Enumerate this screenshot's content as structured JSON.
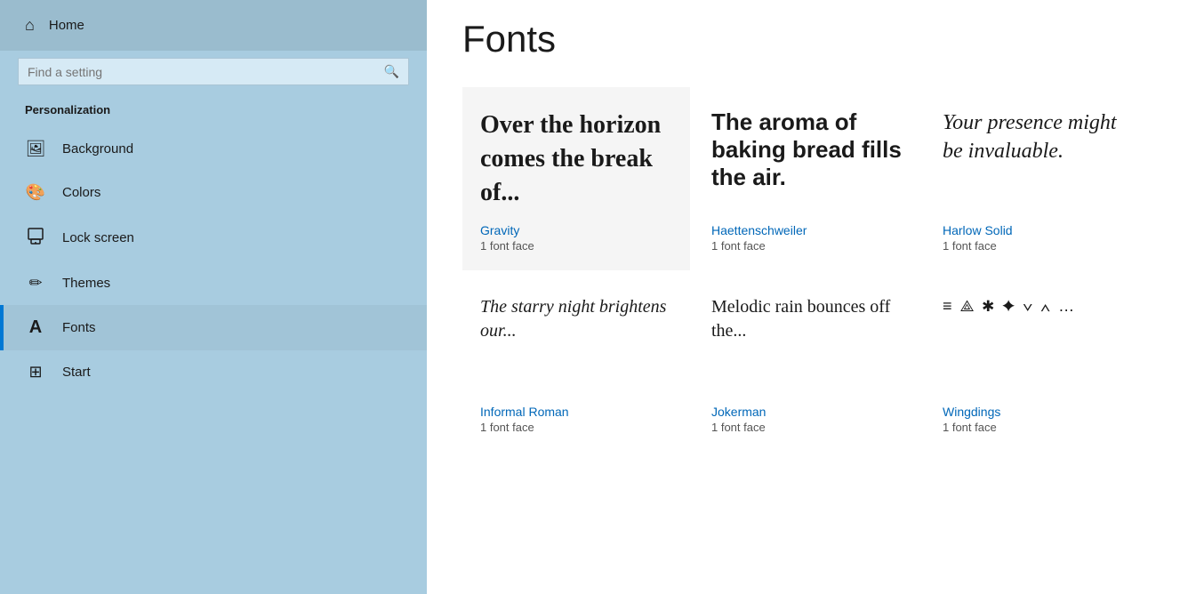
{
  "sidebar": {
    "home_label": "Home",
    "search_placeholder": "Find a setting",
    "section_label": "Personalization",
    "nav_items": [
      {
        "id": "background",
        "label": "Background",
        "icon": "🖼"
      },
      {
        "id": "colors",
        "label": "Colors",
        "icon": "🎨"
      },
      {
        "id": "lock-screen",
        "label": "Lock screen",
        "icon": "🔒"
      },
      {
        "id": "themes",
        "label": "Themes",
        "icon": "✏"
      },
      {
        "id": "fonts",
        "label": "Fonts",
        "icon": "A",
        "active": true
      },
      {
        "id": "start",
        "label": "Start",
        "icon": "⊞"
      }
    ]
  },
  "main": {
    "title": "Fonts",
    "font_cards": [
      {
        "preview": "Over the horizon comes the break of...",
        "name": "Gravity",
        "faces": "1 font face",
        "style": "gravity",
        "bg": "gray"
      },
      {
        "preview": "The aroma of baking bread fills the air.",
        "name": "Haettenschweiler",
        "faces": "1 font face",
        "style": "haettenschweiler",
        "bg": "white"
      },
      {
        "preview": "Your presence might be invaluable.",
        "name": "Harlow Solid",
        "faces": "1 font face",
        "style": "harlow",
        "bg": "white"
      },
      {
        "preview": "The starry night brightens our...",
        "name": "Informal Roman",
        "faces": "1 font face",
        "style": "row2-1",
        "bg": "white"
      },
      {
        "preview": "Melodic rain bounces off the...",
        "name": "Jokerman",
        "faces": "1 font face",
        "style": "row2-2",
        "bg": "white"
      },
      {
        "preview": "≡ ⟁ ✱ ✦ ∨ ∧ …",
        "name": "Wingdings",
        "faces": "1 font face",
        "style": "row2-3",
        "bg": "white"
      }
    ]
  }
}
